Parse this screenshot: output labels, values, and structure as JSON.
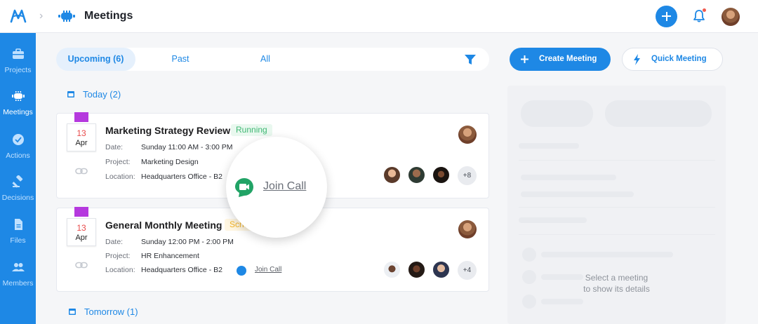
{
  "header": {
    "title": "Meetings"
  },
  "sidebar": {
    "items": [
      {
        "label": "Projects",
        "icon": "briefcase-icon"
      },
      {
        "label": "Meetings",
        "icon": "meetings-icon",
        "active": true
      },
      {
        "label": "Actions",
        "icon": "check-circle-icon"
      },
      {
        "label": "Decisions",
        "icon": "gavel-icon"
      },
      {
        "label": "Files",
        "icon": "file-icon"
      },
      {
        "label": "Members",
        "icon": "people-icon"
      }
    ]
  },
  "tabs": [
    {
      "label": "Upcoming (6)",
      "active": true
    },
    {
      "label": "Past"
    },
    {
      "label": "All"
    }
  ],
  "actions": {
    "create": "Create Meeting",
    "quick": "Quick Meeting"
  },
  "sections": {
    "today": "Today (2)",
    "tomorrow": "Tomorrow (1)"
  },
  "meetings": [
    {
      "day": "13",
      "month": "Apr",
      "title": "Marketing Strategy Review",
      "status": "Running",
      "date_label": "Date:",
      "date": "Sunday 11:00 AM - 3:00 PM",
      "project_label": "Project:",
      "project": "Marketing Design",
      "location_label": "Location:",
      "location": "Headquarters Office - B2",
      "extra_attendees": "+8"
    },
    {
      "day": "13",
      "month": "Apr",
      "title": "General Monthly Meeting",
      "status": "Sche",
      "date_label": "Date:",
      "date": "Sunday 12:00 PM - 2:00 PM",
      "project_label": "Project:",
      "project": "HR Enhancement",
      "location_label": "Location:",
      "location": "Headquarters Office - B2",
      "join_label": "Join Call",
      "extra_attendees": "+4"
    }
  ],
  "magnifier": {
    "join_label": "Join Call"
  },
  "detail": {
    "empty_line1": "Select a meeting",
    "empty_line2": "to show its details"
  },
  "colors": {
    "brand": "#1e88e5",
    "sidebar": "#1e88e5",
    "running": "#3fb873",
    "scheduled": "#f2b42a",
    "date_flag": "#b539de",
    "date_red": "#e84a4a"
  }
}
